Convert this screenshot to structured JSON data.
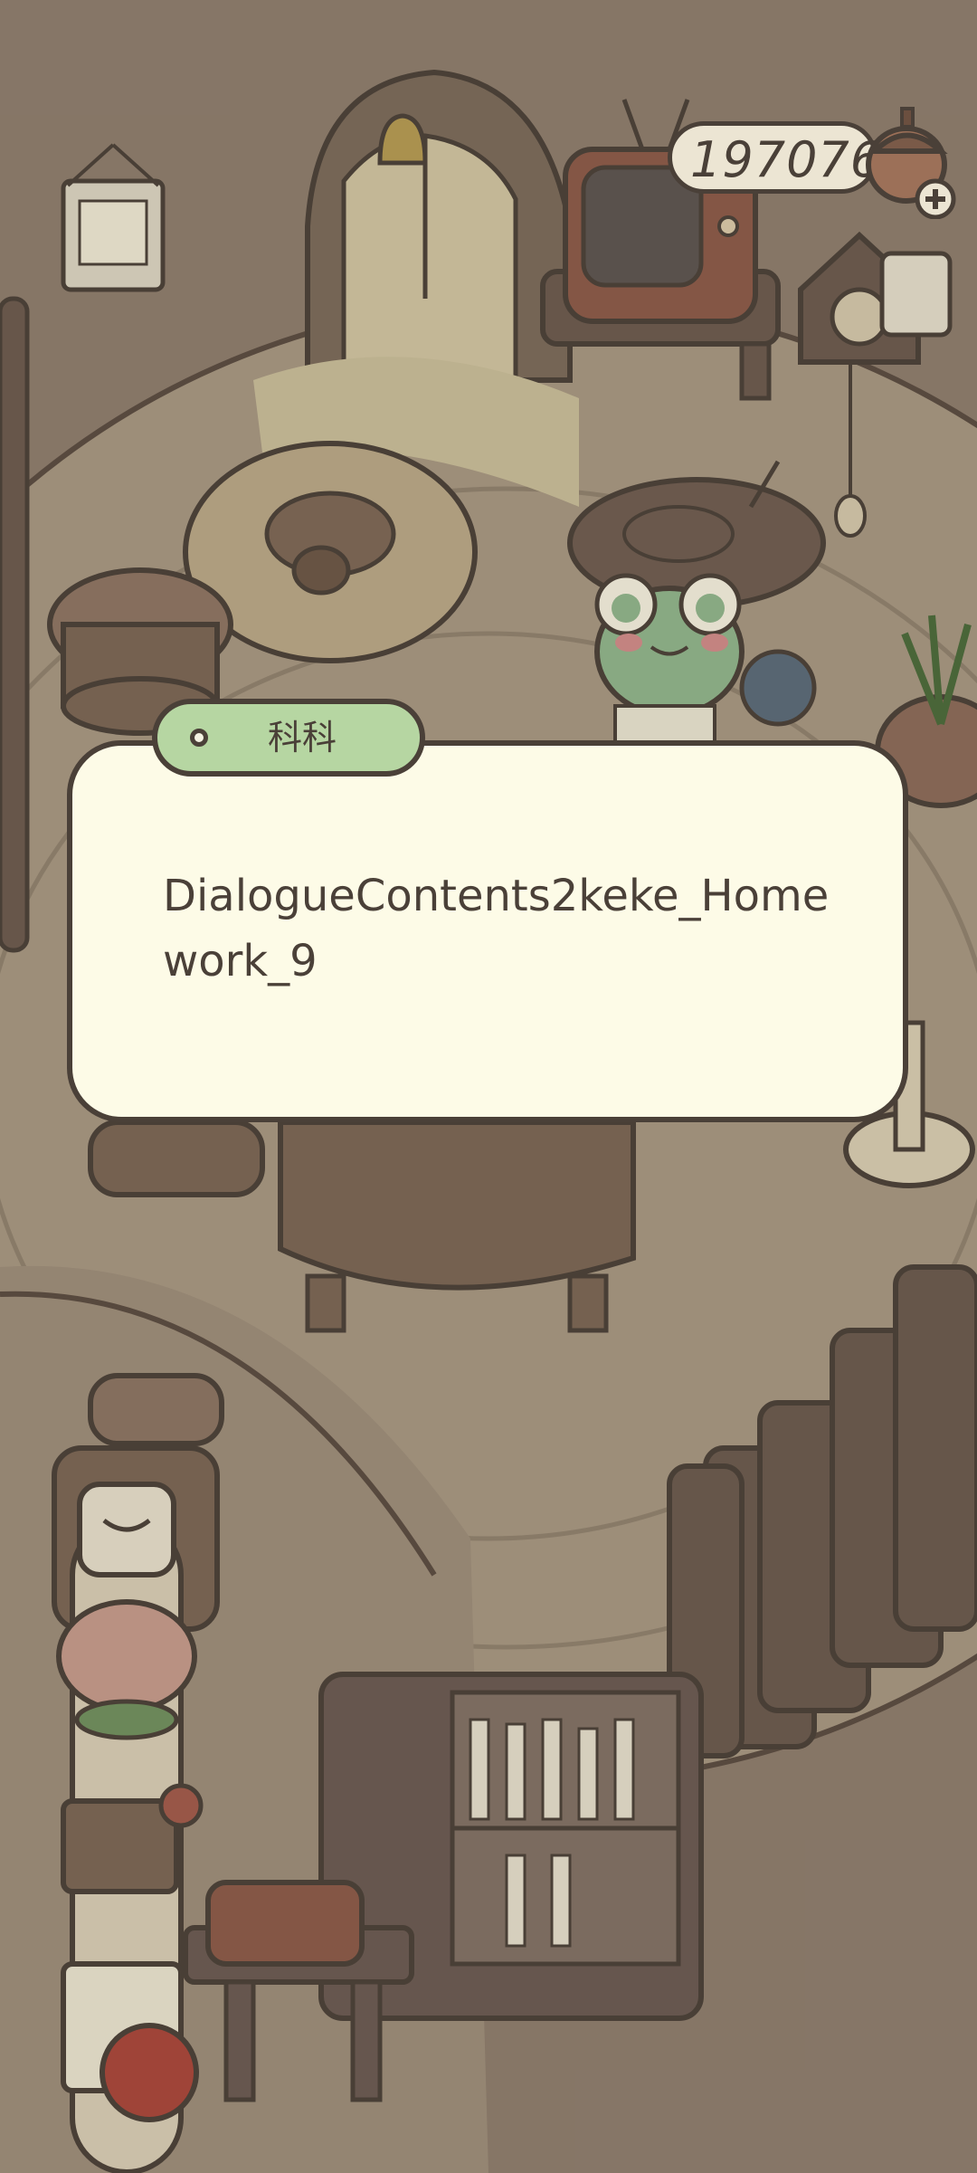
{
  "currency": {
    "value": "197076",
    "icon": "acorn-coin-icon",
    "add_icon": "plus-icon"
  },
  "dialog": {
    "speaker": "科科",
    "text": "DialogueContents2keke_Homework_9"
  },
  "colors": {
    "dialog_bg": "#fdfbe7",
    "speaker_tag_bg": "#b6d6a2",
    "outline": "#4a4038",
    "room_floor": "#a5967f",
    "room_wall": "#8a7a6a"
  }
}
